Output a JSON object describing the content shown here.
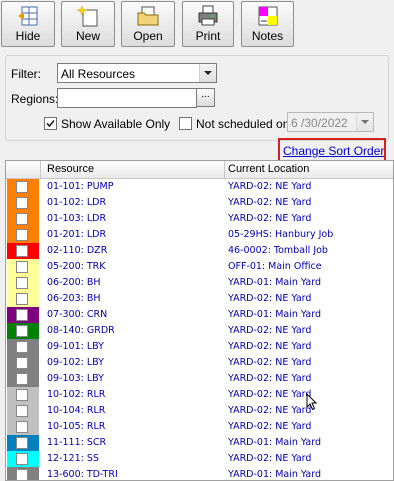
{
  "toolbar": {
    "buttons": [
      {
        "label": "Hide",
        "icon": "hide-icon"
      },
      {
        "label": "New",
        "icon": "new-icon"
      },
      {
        "label": "Open",
        "icon": "open-folder-icon"
      },
      {
        "label": "Print",
        "icon": "printer-icon"
      },
      {
        "label": "Notes",
        "icon": "notes-icon"
      }
    ]
  },
  "filters": {
    "filter_label": "Filter:",
    "filter_value": "All Resources",
    "regions_label": "Regions:",
    "regions_value": "",
    "browse_label": "...",
    "available_only_label": "Show Available Only",
    "available_only_checked": true,
    "not_scheduled_label": "Not scheduled on",
    "not_scheduled_checked": false,
    "date_value": "6 /30/2022"
  },
  "sort_link": "Change Sort Order",
  "grid": {
    "columns": [
      "Resource",
      "Current Location"
    ],
    "rows": [
      {
        "color": "#ff7f00",
        "resource": "01-101: PUMP",
        "location": "YARD-02: NE Yard"
      },
      {
        "color": "#ff7f00",
        "resource": "01-102: LDR",
        "location": "YARD-02: NE Yard"
      },
      {
        "color": "#ff7f00",
        "resource": "01-103: LDR",
        "location": "YARD-02: NE Yard"
      },
      {
        "color": "#ff7f00",
        "resource": "01-201: LDR",
        "location": "05-29HS: Hanbury Job"
      },
      {
        "color": "#ff0000",
        "resource": "02-110: DZR",
        "location": "46-0002: Tomball Job"
      },
      {
        "color": "#ffff99",
        "resource": "05-200: TRK",
        "location": "OFF-01: Main Office"
      },
      {
        "color": "#ffff99",
        "resource": "06-200: BH",
        "location": "YARD-01: Main Yard"
      },
      {
        "color": "#ffff99",
        "resource": "06-203: BH",
        "location": "YARD-02: NE Yard"
      },
      {
        "color": "#800080",
        "resource": "07-300: CRN",
        "location": "YARD-01: Main Yard"
      },
      {
        "color": "#008000",
        "resource": "08-140: GRDR",
        "location": "YARD-02: NE Yard"
      },
      {
        "color": "#808080",
        "resource": "09-101: LBY",
        "location": "YARD-02: NE Yard"
      },
      {
        "color": "#808080",
        "resource": "09-102: LBY",
        "location": "YARD-02: NE Yard"
      },
      {
        "color": "#808080",
        "resource": "09-103: LBY",
        "location": "YARD-02: NE Yard"
      },
      {
        "color": "#c0c0c0",
        "resource": "10-102: RLR",
        "location": "YARD-02: NE Yard"
      },
      {
        "color": "#c0c0c0",
        "resource": "10-104: RLR",
        "location": "YARD-02: NE Yard"
      },
      {
        "color": "#c0c0c0",
        "resource": "10-105: RLR",
        "location": "YARD-02: NE Yard"
      },
      {
        "color": "#0080c0",
        "resource": "11-111: SCR",
        "location": "YARD-01: Main Yard"
      },
      {
        "color": "#00ffff",
        "resource": "12-121: SS",
        "location": "YARD-02: NE Yard"
      },
      {
        "color": "#808080",
        "resource": "13-600: TD-TRI",
        "location": "YARD-01: Main Yard"
      }
    ]
  }
}
